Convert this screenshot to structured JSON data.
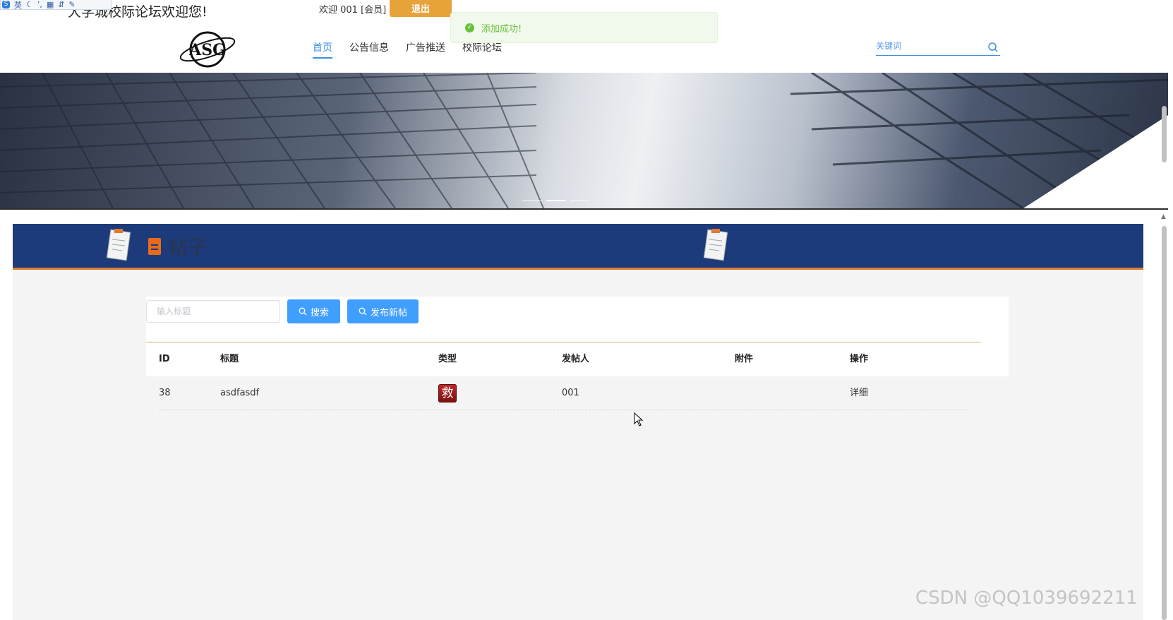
{
  "ime_toolbar": {
    "label": "英"
  },
  "header": {
    "site_title": "大学城校际论坛欢迎您!",
    "welcome_text": "欢迎 001 [会员]",
    "logout_label": "退出",
    "logo_text": "ASG"
  },
  "toast": {
    "message": "添加成功!"
  },
  "nav": {
    "items": [
      {
        "label": "首页",
        "active": true
      },
      {
        "label": "公告信息",
        "active": false
      },
      {
        "label": "广告推送",
        "active": false
      },
      {
        "label": "校际论坛",
        "active": false
      }
    ]
  },
  "search": {
    "placeholder": "关键词"
  },
  "section": {
    "title": "帖子"
  },
  "toolbar": {
    "title_placeholder": "输入标题",
    "search_label": "搜索",
    "new_post_label": "发布新帖"
  },
  "table": {
    "columns": [
      "ID",
      "标题",
      "类型",
      "发帖人",
      "附件",
      "操作"
    ],
    "rows": [
      {
        "id": "38",
        "title": "asdfasdf",
        "type_char": "救",
        "author": "001",
        "attachment": "",
        "action": "详细"
      }
    ]
  },
  "watermark": {
    "text": "CSDN @QQ1039692211"
  },
  "colors": {
    "primary": "#409eff",
    "logout": "#e6a33a",
    "success": "#67c23a",
    "section_header": "#1d3a7a",
    "accent_orange": "#e86a1c"
  }
}
